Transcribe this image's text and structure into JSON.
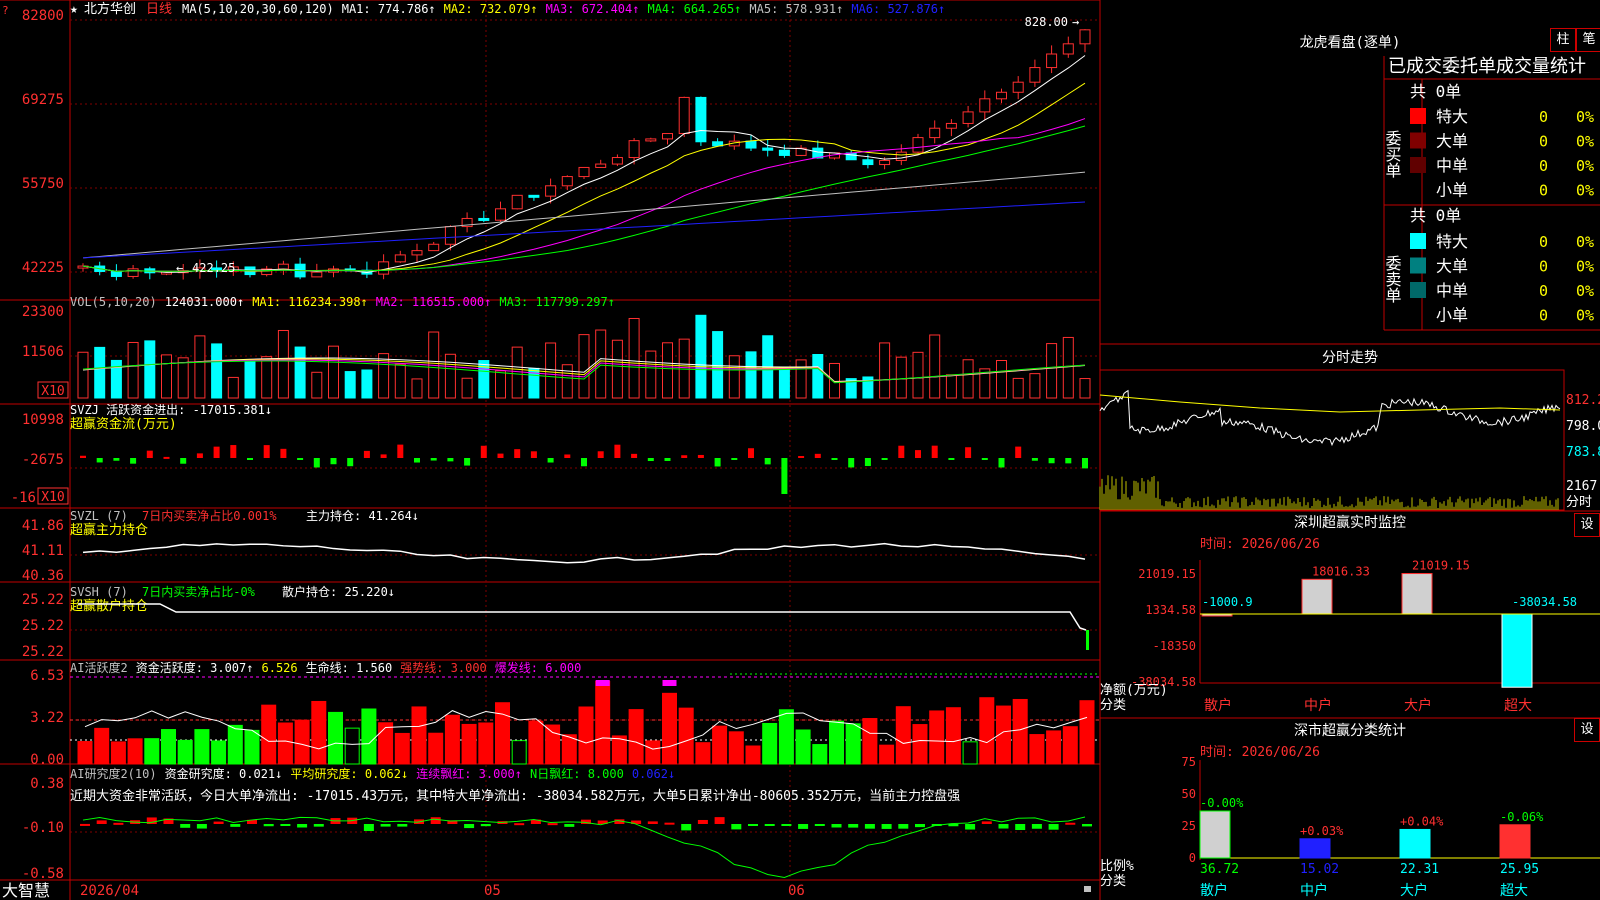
{
  "stock": {
    "name": "北方华创",
    "period": "日线",
    "logo": "大智慧"
  },
  "price_axis": [
    "82800",
    "69275",
    "55750",
    "42225"
  ],
  "price_markers": {
    "high": "828.00",
    "low": "422.25"
  },
  "ma_header": [
    {
      "label": "MA(5,10,20,30,60,120)",
      "color": "#ffffff"
    },
    {
      "label": "MA1: 774.786↑",
      "color": "#ffffff"
    },
    {
      "label": "MA2: 732.079↑",
      "color": "#ffff00"
    },
    {
      "label": "MA3: 672.404↑",
      "color": "#ff00ff"
    },
    {
      "label": "MA4: 664.265↑",
      "color": "#00ff00"
    },
    {
      "label": "MA5: 578.931↑",
      "color": "#c0c0c0"
    },
    {
      "label": "MA6: 527.876↑",
      "color": "#2020ff"
    }
  ],
  "vol_header": [
    {
      "label": "VOL(5,10,20)",
      "color": "#c0c0c0"
    },
    {
      "label": "124031.000↑",
      "color": "#ffffff"
    },
    {
      "label": "MA1: 116234.398↑",
      "color": "#ffff00"
    },
    {
      "label": "MA2: 116515.000↑",
      "color": "#ff00ff"
    },
    {
      "label": "MA3: 117799.297↑",
      "color": "#00ff00"
    }
  ],
  "vol_axis": [
    "23300",
    "11506"
  ],
  "x10_label": "X10",
  "svzj": {
    "header": "SVZJ  活跃资金进出: -17015.381↓",
    "subtitle": "超赢资金流(万元)",
    "axis": [
      "10998",
      "-2675",
      "-16"
    ]
  },
  "svzl": {
    "header": "SVZL (7)",
    "sub": "7日内买卖净占比0.001%",
    "hold": "主力持仓: 41.264↓",
    "subtitle": "超赢主力持仓",
    "axis": [
      "41.86",
      "41.11",
      "40.36"
    ]
  },
  "svsh": {
    "header": "SVSH (7)",
    "sub": "7日内买卖净占比-0%",
    "hold": "散户持仓: 25.220↓",
    "subtitle": "超赢散户持仓",
    "axis": [
      "25.22",
      "25.22",
      "25.22"
    ]
  },
  "ai_act": {
    "parts": [
      {
        "label": "AI活跃度2",
        "color": "#c0c0c0"
      },
      {
        "label": "资金活跃度: 3.007↑",
        "color": "#ffffff"
      },
      {
        "label": "6.526",
        "color": "#ffff00"
      },
      {
        "label": "生命线: 1.560",
        "color": "#ffffff"
      },
      {
        "label": "强势线: 3.000",
        "color": "#ff3030"
      },
      {
        "label": "爆发线: 6.000",
        "color": "#ff00ff"
      }
    ],
    "axis": [
      "6.53",
      "3.22",
      "0.00"
    ]
  },
  "ai_res": {
    "parts": [
      {
        "label": "AI研究度2(10)",
        "color": "#c0c0c0"
      },
      {
        "label": "资金研究度: 0.021↓",
        "color": "#ffffff"
      },
      {
        "label": "平均研究度: 0.062↓",
        "color": "#ffff00"
      },
      {
        "label": "连续飘红: 3.000↑",
        "color": "#ff00ff"
      },
      {
        "label": "N日飘红: 8.000",
        "color": "#00ff00"
      },
      {
        "label": "0.062↓",
        "color": "#2020ff"
      }
    ],
    "note": "近期大资金非常活跃，今日大单净流出: -17015.43万元，其中特大单净流出: -38034.582万元，大单5日累计净出-80605.352万元，当前主力控盘强",
    "axis": [
      "0.38",
      "-0.10",
      "-0.58"
    ]
  },
  "date_axis": [
    "2026/04",
    "05",
    "06"
  ],
  "right_panel": {
    "dragon_title": "龙虎看盘(逐单)",
    "tabs": [
      "柱",
      "笔"
    ],
    "stat_title": "已成交委托单成交量统计",
    "buy_label": "委买单",
    "sell_label": "委卖单",
    "buy_total": "共 0单",
    "sell_total": "共 0单",
    "buy_rows": [
      {
        "label": "特大",
        "count": "0",
        "pct": "0%",
        "color": "#ff0000"
      },
      {
        "label": "大单",
        "count": "0",
        "pct": "0%",
        "color": "#800000"
      },
      {
        "label": "中单",
        "count": "0",
        "pct": "0%",
        "color": "#600000"
      },
      {
        "label": "小单",
        "count": "0",
        "pct": "0%",
        "color": ""
      }
    ],
    "sell_rows": [
      {
        "label": "特大",
        "count": "0",
        "pct": "0%",
        "color": "#00ffff"
      },
      {
        "label": "大单",
        "count": "0",
        "pct": "0%",
        "color": "#008080"
      },
      {
        "label": "中单",
        "count": "0",
        "pct": "0%",
        "color": "#006868"
      },
      {
        "label": "小单",
        "count": "0",
        "pct": "0%",
        "color": ""
      }
    ],
    "intraday_title": "分时走势",
    "intraday_axis": [
      "812.2",
      "798.0",
      "783.8",
      "2167",
      "分时"
    ],
    "monitor_title": "深圳超赢实时监控",
    "monitor_set": "设",
    "monitor_time": "时间: 2026/06/26",
    "monitor_axis": [
      "21019.15",
      "1334.58",
      "-18350",
      "-38034.58"
    ],
    "monitor_values": [
      "-1000.9",
      "18016.33",
      "21019.15",
      "-38034.58"
    ],
    "monitor_ylabel": "净额(万元)",
    "monitor_xlabel": "分类",
    "categories": [
      "散户",
      "中户",
      "大户",
      "超大"
    ],
    "class_title": "深市超赢分类统计",
    "class_set": "设",
    "class_time": "时间: 2026/06/26",
    "class_axis": [
      "75",
      "50",
      "25",
      "0"
    ],
    "class_pct_labels": [
      "-0.00%",
      "+0.03%",
      "+0.04%",
      "-0.06%"
    ],
    "class_values": [
      "36.72",
      "15.02",
      "22.31",
      "25.95"
    ],
    "class_ylabel": "比例%",
    "class_xlabel": "分类"
  }
}
